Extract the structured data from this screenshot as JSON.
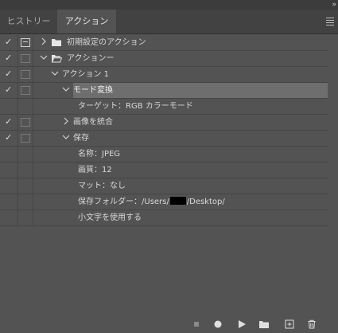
{
  "window": {
    "collapse_glyph": "»"
  },
  "tabs": [
    {
      "label": "ヒストリー",
      "active": false
    },
    {
      "label": "アクション",
      "active": true
    }
  ],
  "actions": [
    {
      "label": "初期設定のアクション",
      "checked": true,
      "dialog": true,
      "expanded": false,
      "type": "set",
      "indent": 0
    },
    {
      "label": "アクションー",
      "checked": true,
      "dialog": false,
      "expanded": true,
      "type": "set",
      "indent": 0
    },
    {
      "label": "アクション 1",
      "checked": true,
      "dialog": false,
      "expanded": true,
      "type": "action",
      "indent": 1
    },
    {
      "label": "モード変換",
      "checked": true,
      "dialog": false,
      "expanded": true,
      "type": "step",
      "indent": 2,
      "selected": true
    },
    {
      "label": "ターゲット：RGB カラーモード",
      "type": "detail",
      "indent": 3
    },
    {
      "label": "画像を統合",
      "checked": true,
      "dialog": false,
      "type": "step",
      "indent": 2
    },
    {
      "label": "保存",
      "checked": true,
      "dialog": false,
      "expanded": true,
      "type": "step",
      "indent": 2
    },
    {
      "label": "名称：JPEG",
      "type": "detail",
      "indent": 3
    },
    {
      "label": "画質：12",
      "type": "detail",
      "indent": 3
    },
    {
      "label": "マット：なし",
      "type": "detail",
      "indent": 3
    },
    {
      "label_prefix": "保存フォルダー：/Users/",
      "label_suffix": "/Desktop/",
      "redacted": true,
      "type": "detail",
      "indent": 3
    },
    {
      "label": "小文字を使用する",
      "type": "detail",
      "indent": 3
    }
  ],
  "toolbar": {
    "stop": "stop-icon",
    "record": "record-icon",
    "play": "play-icon",
    "new_set": "folder-icon",
    "new_action": "new-action-icon",
    "delete": "trash-icon"
  }
}
